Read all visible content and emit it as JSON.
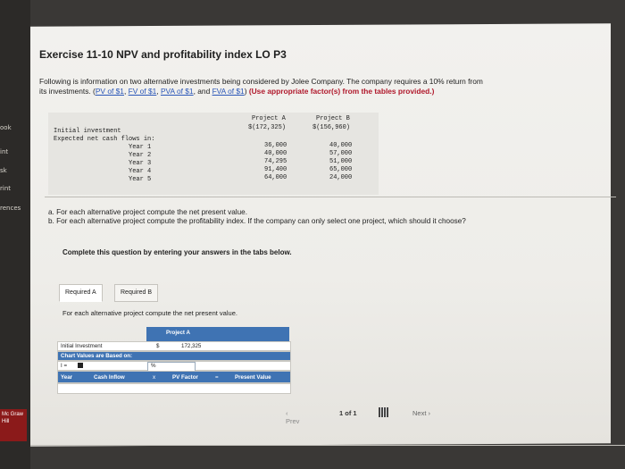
{
  "sidebar": {
    "items": [
      "ook",
      "int",
      "sk",
      "rint",
      "rences"
    ],
    "logo": "Mc Graw Hill"
  },
  "title": "Exercise 11-10 NPV and profitability index LO P3",
  "intro": {
    "line1": "Following is information on two alternative investments being considered by Jolee Company. The company requires a 10% return from",
    "line2_prefix": "its investments. (",
    "links": [
      "PV of $1",
      "FV of $1",
      "PVA of $1",
      "FVA of $1"
    ],
    "sep1": ", ",
    "sep2": ", ",
    "sep3": ", and ",
    "line2_mid": ") ",
    "instruction": "(Use appropriate factor(s) from the tables provided.)"
  },
  "table": {
    "col_a": "Project A",
    "col_b": "Project B",
    "row_initial": "Initial investment",
    "initial_a": "$(172,325)",
    "initial_b": "$(156,960)",
    "row_expected": "Expected net cash flows in:",
    "years": [
      "Year 1",
      "Year 2",
      "Year 3",
      "Year 4",
      "Year 5"
    ],
    "flows_a": [
      "36,000",
      "40,000",
      "74,295",
      "91,400",
      "64,000"
    ],
    "flows_b": [
      "40,000",
      "57,000",
      "51,000",
      "65,000",
      "24,000"
    ]
  },
  "questions": {
    "a": "a. For each alternative project compute the net present value.",
    "b": "b. For each alternative project compute the profitability index. If the company can only select one project, which should it choose?"
  },
  "complete": "Complete this question by entering your answers in the tabs below.",
  "tabs": [
    "Required A",
    "Required B"
  ],
  "sub_question": "For each alternative project compute the net present value.",
  "worksheet": {
    "header": "Project A",
    "initial_label": "Initial Investment",
    "dollar": "$",
    "initial_value": "172,325",
    "chart_values": "Chart Values are Based on:",
    "i_label": "I =",
    "pct": "%",
    "col_year": "Year",
    "col_cash": "Cash Inflow",
    "times": "x",
    "col_pv": "PV Factor",
    "eq": "=",
    "col_present": "Present Value"
  },
  "pager": {
    "prev": "Prev",
    "page": "1 of 1",
    "next": "Next"
  }
}
